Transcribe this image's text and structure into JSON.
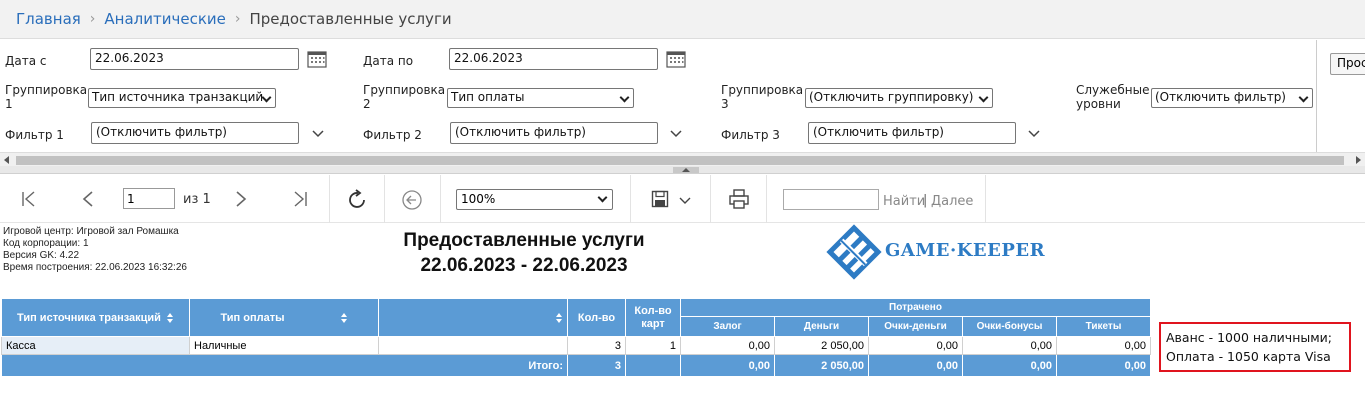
{
  "breadcrumb": {
    "home": "Главная",
    "section": "Аналитические",
    "current": "Предоставленные услуги"
  },
  "params": {
    "date_from_label": "Дата с",
    "date_from_value": "22.06.2023",
    "date_to_label": "Дата по",
    "date_to_value": "22.06.2023",
    "group1_label": "Группировка 1",
    "group1_value": "Тип источника транзакций",
    "group2_label": "Группировка 2",
    "group2_value": "Тип оплаты",
    "group3_label": "Группировка 3",
    "group3_value": "(Отключить группировку)",
    "service_label": "Служебные уровни",
    "service_value": "(Отключить фильтр)",
    "filter1_label": "Фильтр 1",
    "filter1_value": "(Отключить фильтр)",
    "filter2_label": "Фильтр 2",
    "filter2_value": "(Отключить фильтр)",
    "filter3_label": "Фильтр 3",
    "filter3_value": "(Отключить фильтр)",
    "view_button": "Прос"
  },
  "toolbar": {
    "page_value": "1",
    "page_of": "из 1",
    "zoom": "100%",
    "find": "Найти",
    "find_sep": "|",
    "next": "Далее"
  },
  "report": {
    "meta": [
      "Игровой центр: Игровой зал Ромашка",
      "Код корпорации: 1",
      "Версия GK: 4.22",
      "Время построения: 22.06.2023 16:32:26"
    ],
    "title": "Предоставленные услуги",
    "period": "22.06.2023 - 22.06.2023",
    "logo_text": "GAME·KEEPER",
    "columns": {
      "source": "Тип источника транзакций",
      "payment": "Тип оплаты",
      "blank": "",
      "qty": "Кол-во",
      "qty_cards": "Кол-во карт",
      "spent": "Потрачено",
      "deposit": "Залог",
      "money": "Деньги",
      "points_money": "Очки-деньги",
      "points_bonus": "Очки-бонусы",
      "tickets": "Тикеты"
    },
    "rows": [
      {
        "source": "Касса",
        "payment": "Наличные",
        "blank": "",
        "qty": "3",
        "qty_cards": "1",
        "deposit": "0,00",
        "money": "2 050,00",
        "points_money": "0,00",
        "points_bonus": "0,00",
        "tickets": "0,00"
      }
    ],
    "total": {
      "label": "Итого:",
      "qty": "3",
      "qty_cards": "",
      "deposit": "0,00",
      "money": "2 050,00",
      "points_money": "0,00",
      "points_bonus": "0,00",
      "tickets": "0,00"
    },
    "annotation_line1": "Аванс - 1000 наличными;",
    "annotation_line2": "Оплата - 1050 карта Visa"
  },
  "colors": {
    "header_blue": "#5b9bd5",
    "link_blue": "#2a6ebb",
    "annotation_border": "#e0141e",
    "logo_blue": "#2d7bc4"
  }
}
